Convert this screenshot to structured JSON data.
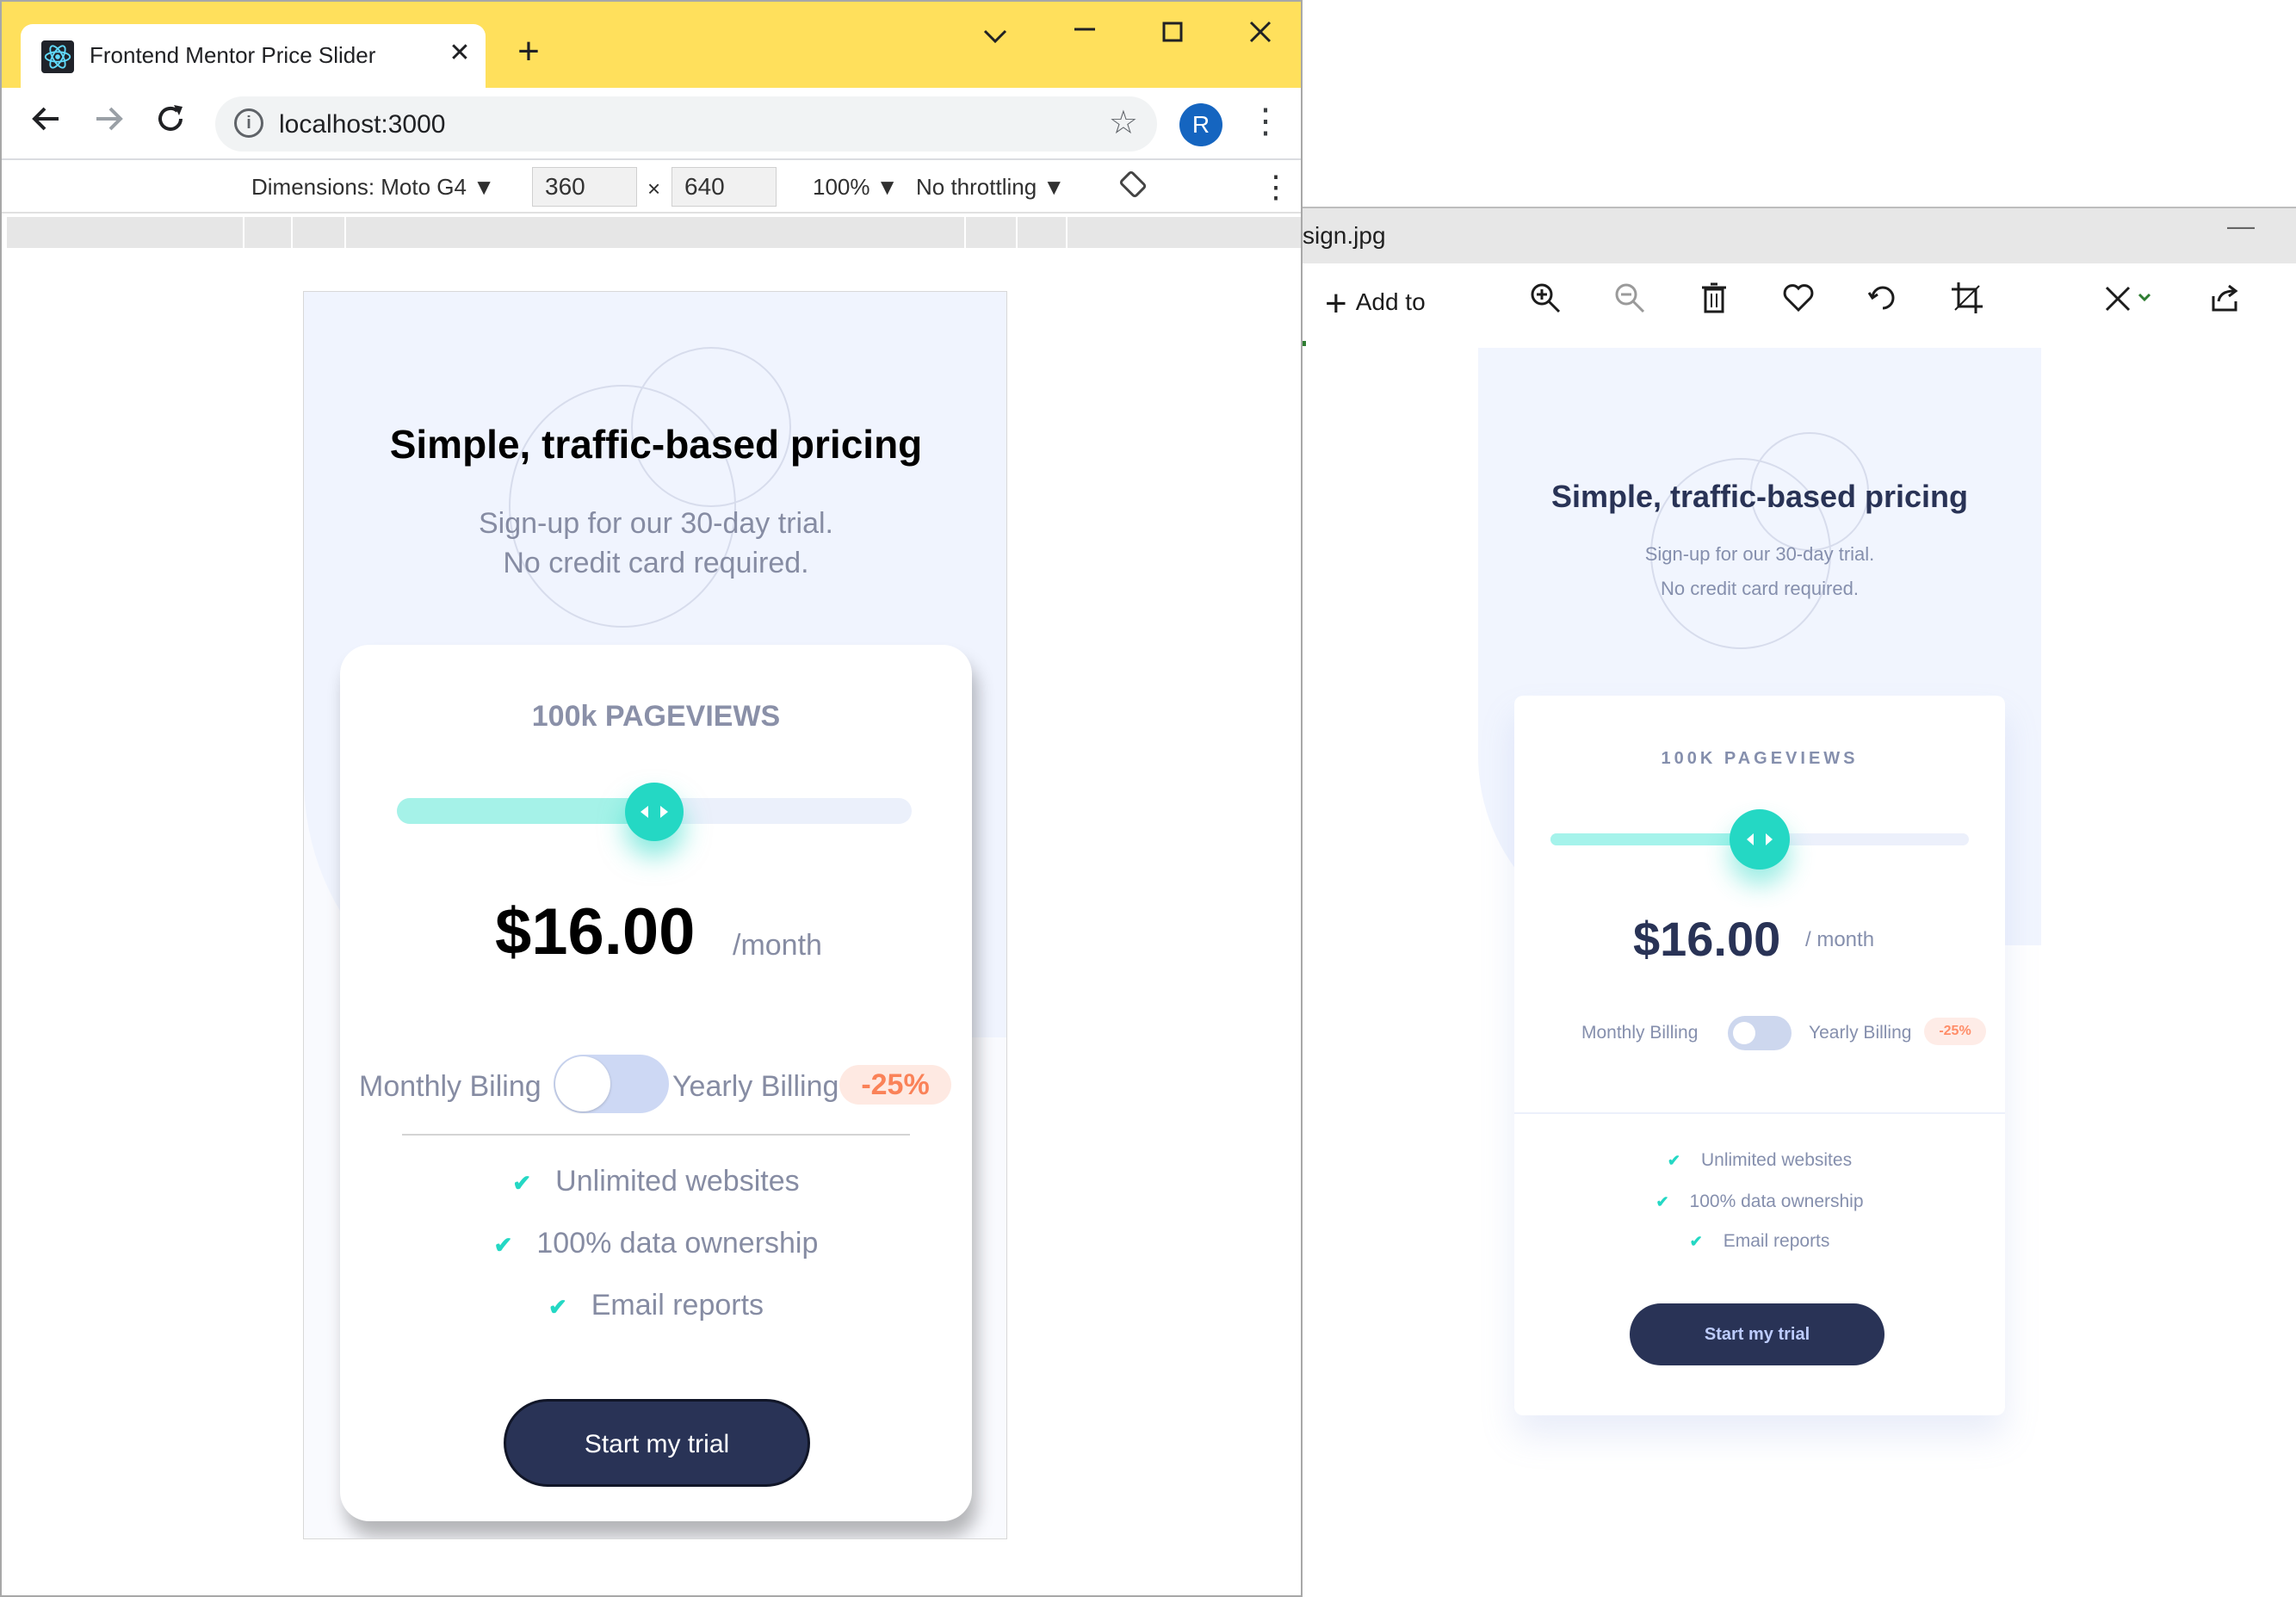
{
  "browser": {
    "tab_title": "Frontend Mentor Price Slider",
    "tab_close": "✕",
    "new_tab": "+",
    "url": "localhost:3000",
    "profile_initial": "R",
    "devtools": {
      "dimensions_label": "Dimensions: Moto G4 ▼",
      "width": "360",
      "times": "×",
      "height": "640",
      "zoom": "100% ▼",
      "throttling": "No throttling ▼"
    },
    "icons": {
      "back": "back-arrow-icon",
      "forward": "forward-arrow-icon",
      "reload": "reload-icon",
      "info": "info-icon",
      "star": "bookmark-star-icon",
      "menu": "kebab-menu-icon",
      "rotate": "rotate-icon"
    }
  },
  "app": {
    "heading": "Simple, traffic-based pricing",
    "subtitle_line1": "Sign-up for our 30-day trial.",
    "subtitle_line2": "No credit card required.",
    "pageviews": "100k PAGEVIEWS",
    "slider_level": 0.5,
    "price": "$16.00",
    "period": "/month",
    "monthly_label": "Monthly Biling",
    "yearly_label": "Yearly Billing",
    "discount": "-25%",
    "features": [
      "Unlimited websites",
      "100% data ownership",
      "Email reports"
    ],
    "checkmark": "✔",
    "cta": "Start my trial",
    "toggle_on": false
  },
  "viewer": {
    "filename": "sign.jpg",
    "minimize": "—",
    "add_to": "Add to",
    "tools": [
      "zoom-in-icon",
      "zoom-out-icon",
      "delete-icon",
      "favorite-heart-icon",
      "rotate-icon",
      "crop-icon",
      "edit-icon",
      "share-icon"
    ]
  },
  "design": {
    "heading": "Simple, traffic-based pricing",
    "subtitle_line1": "Sign-up for our 30-day trial.",
    "subtitle_line2": "No credit card required.",
    "pageviews": "100K PAGEVIEWS",
    "slider_level": 0.5,
    "price": "$16.00",
    "period": "/ month",
    "monthly_label": "Monthly Billing",
    "yearly_label": "Yearly Billing",
    "discount": "-25%",
    "features": [
      "Unlimited websites",
      "100% data ownership",
      "Email reports"
    ],
    "checkmark": "✔",
    "cta": "Start my trial"
  },
  "colors": {
    "chrome_tabstrip": "#ffe05c",
    "accent_teal": "#24d8c4",
    "slider_fill": "#a5f2e8",
    "dark_navy": "#293356",
    "discount_text": "#fa8258",
    "grayish_blue": "#868ca3"
  }
}
